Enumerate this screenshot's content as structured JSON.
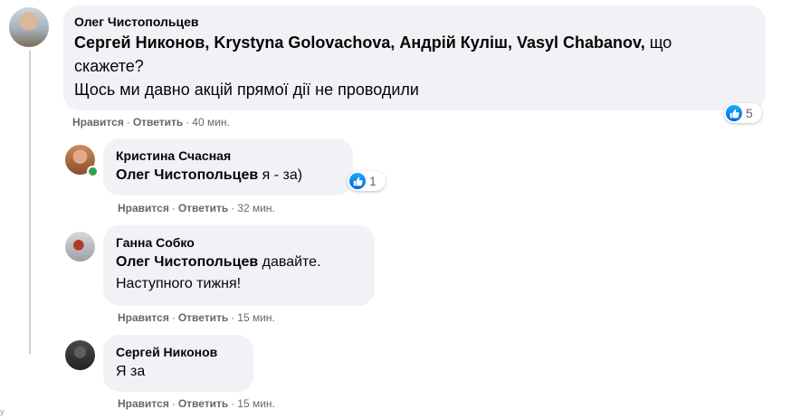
{
  "comments": [
    {
      "author": "Олег Чистопольцев",
      "line1_mentions": "Сергей Никонов, Krystyna Golovachova, Андрій Куліш, Vasyl Chabanov,",
      "line1_rest": " що",
      "line2": "скажете?",
      "line3": "Щось ми давно акцій прямої дії не проводили",
      "like": "Нравится",
      "reply": "Ответить",
      "time": "40 мин.",
      "reaction_count": "5"
    },
    {
      "author": "Кристина Счасная",
      "mention": "Олег Чистопольцев",
      "text": " я - за)",
      "like": "Нравится",
      "reply": "Ответить",
      "time": "32 мин.",
      "reaction_count": "1"
    },
    {
      "author": "Ганна Собко",
      "mention": "Олег Чистопольцев",
      "text": " давайте.",
      "line2": "Наступного тижня!",
      "like": "Нравится",
      "reply": "Ответить",
      "time": "15 мин."
    },
    {
      "author": "Сергей Никонов",
      "text": "Я за",
      "like": "Нравится",
      "reply": "Ответить",
      "time": "15 мин."
    }
  ],
  "separator": "·",
  "edge_text": "y",
  "colors": {
    "bubble": "#f0f2f5",
    "like_blue": "#1877f2",
    "meta_gray": "#65676b",
    "online_green": "#31a24c"
  }
}
